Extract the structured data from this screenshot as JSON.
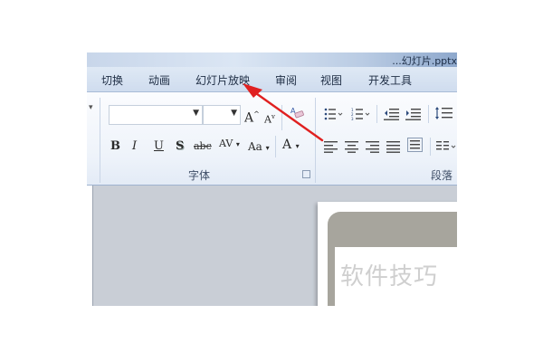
{
  "window": {
    "title_fragment": "...幻灯片.pptx"
  },
  "tabs": [
    {
      "label": "切换"
    },
    {
      "label": "动画"
    },
    {
      "label": "幻灯片放映"
    },
    {
      "label": "审阅"
    },
    {
      "label": "视图"
    },
    {
      "label": "开发工具"
    }
  ],
  "font_group": {
    "label": "字体",
    "font_name_value": "",
    "font_size_value": "",
    "grow_label": "A",
    "shrink_label": "A",
    "bold_label": "B",
    "italic_label": "I",
    "underline_label": "U",
    "shadow_label": "S",
    "strike_label": "abc",
    "spacing_label": "AV",
    "case_label": "Aa",
    "color_label": "A"
  },
  "paragraph_group": {
    "label": "段落"
  },
  "slide": {
    "placeholder_text": "软件技巧"
  },
  "annotation": {
    "arrow_color": "#e02020",
    "points_to": "幻灯片放映"
  }
}
